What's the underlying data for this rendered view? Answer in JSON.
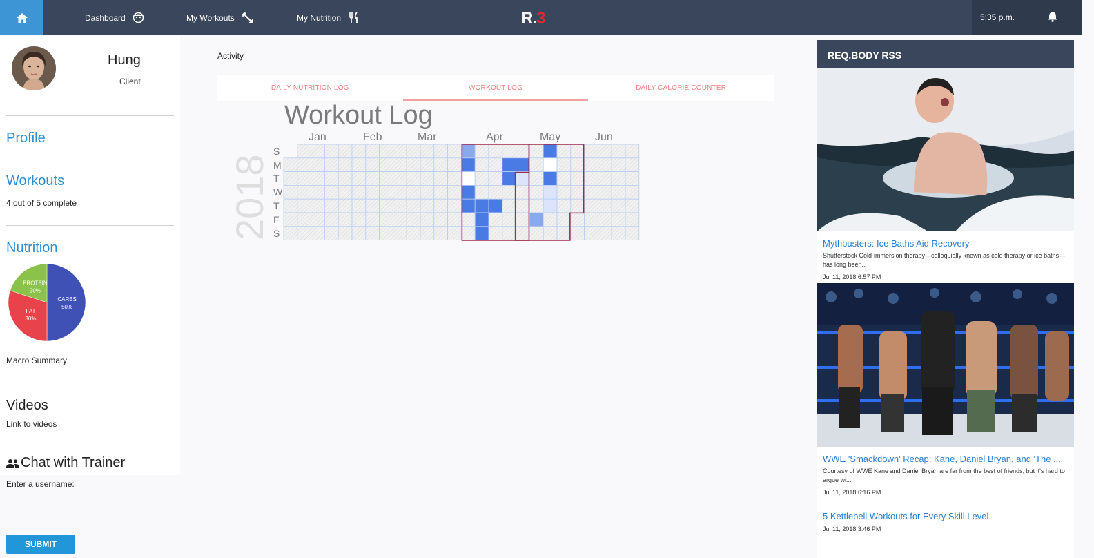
{
  "nav": {
    "items": [
      {
        "label": "Dashboard",
        "icon": "face-icon"
      },
      {
        "label": "My Workouts",
        "icon": "dumbbell-icon"
      },
      {
        "label": "My Nutrition",
        "icon": "utensils-icon"
      }
    ],
    "logo_a": "R.",
    "logo_b": "3",
    "time": "5:35 p.m."
  },
  "sidebar": {
    "user_name": "Hung",
    "user_role": "Client",
    "profile_label": "Profile",
    "workouts_label": "Workouts",
    "workouts_status": "4 out of 5 complete",
    "nutrition_label": "Nutrition",
    "macro": [
      {
        "label": "CARBS",
        "pct": "50%",
        "value": 50,
        "color": "#3f51b5"
      },
      {
        "label": "FAT",
        "pct": "30%",
        "value": 30,
        "color": "#e8434a"
      },
      {
        "label": "PROTEIN",
        "pct": "20%",
        "value": 20,
        "color": "#8bc34a"
      }
    ],
    "macro_summary": "Macro Summary",
    "videos_label": "Videos",
    "videos_link": "Link to videos",
    "chat_label": "Chat with Trainer",
    "username_label": "Enter a username:",
    "submit_label": "SUBMIT"
  },
  "main": {
    "activity_label": "Activity",
    "tabs": [
      {
        "label": "DAILY NUTRITION LOG",
        "active": false
      },
      {
        "label": "WORKOUT LOG",
        "active": true
      },
      {
        "label": "DAILY CALORIE COUNTER",
        "active": false
      }
    ],
    "workout_title": "Workout Log",
    "year": "2018",
    "months": [
      "Jan",
      "Feb",
      "Mar",
      "Apr",
      "May",
      "Jun"
    ],
    "days": [
      "S",
      "M",
      "T",
      "W",
      "T",
      "F",
      "S"
    ]
  },
  "chart_data": {
    "type": "heatmap",
    "title": "Workout Log",
    "year": "2018",
    "rows": [
      "S",
      "M",
      "T",
      "W",
      "T",
      "F",
      "S"
    ],
    "month_labels": [
      "Jan",
      "Feb",
      "Mar",
      "Apr",
      "May",
      "Jun"
    ],
    "active_cells": [
      {
        "week": 13,
        "day": 0,
        "level": 2
      },
      {
        "week": 13,
        "day": 1,
        "level": 3
      },
      {
        "week": 13,
        "day": 2,
        "level": 0
      },
      {
        "week": 13,
        "day": 3,
        "level": 3
      },
      {
        "week": 13,
        "day": 4,
        "level": 3
      },
      {
        "week": 14,
        "day": 4,
        "level": 3
      },
      {
        "week": 14,
        "day": 5,
        "level": 3
      },
      {
        "week": 14,
        "day": 6,
        "level": 3
      },
      {
        "week": 15,
        "day": 4,
        "level": 3
      },
      {
        "week": 16,
        "day": 1,
        "level": 3
      },
      {
        "week": 16,
        "day": 2,
        "level": 3
      },
      {
        "week": 17,
        "day": 1,
        "level": 3
      },
      {
        "week": 17,
        "day": 2,
        "level": 1
      },
      {
        "week": 18,
        "day": 5,
        "level": 2
      },
      {
        "week": 19,
        "day": 0,
        "level": 3
      },
      {
        "week": 19,
        "day": 1,
        "level": 0
      },
      {
        "week": 19,
        "day": 2,
        "level": 3
      },
      {
        "week": 19,
        "day": 3,
        "level": 1
      },
      {
        "week": 19,
        "day": 4,
        "level": 1
      }
    ]
  },
  "rss": {
    "header": "REQ.BODY RSS",
    "items": [
      {
        "title": "Mythbusters: Ice Baths Aid Recovery",
        "snippet": "Shutterstock Cold-immersion therapy—colloquially known as cold therapy or ice baths—has long been...",
        "date": "Jul 11, 2018 6:57 PM"
      },
      {
        "title": "WWE 'Smackdown' Recap: Kane, Daniel Bryan, and 'The ...",
        "snippet": "Courtesy of WWE Kane and Daniel Bryan are far from the best of friends, but it's hard to argue wi...",
        "date": "Jul 11, 2018 6:16 PM"
      },
      {
        "title": "5 Kettlebell Workouts for Every Skill Level",
        "snippet": "",
        "date": "Jul 11, 2018 3:46 PM"
      }
    ]
  }
}
